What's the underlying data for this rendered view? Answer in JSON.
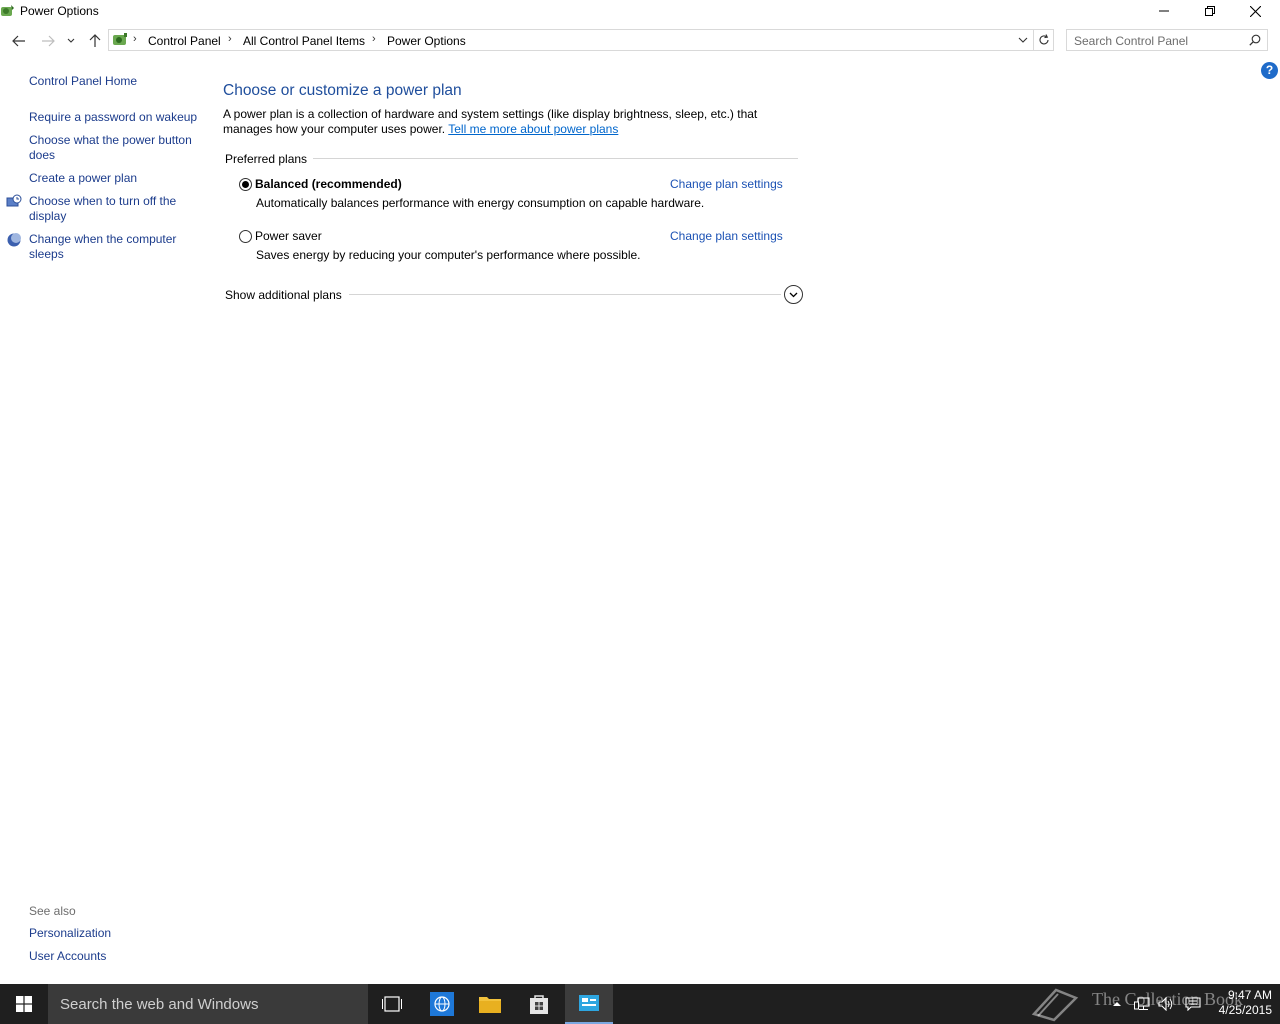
{
  "window": {
    "title": "Power Options"
  },
  "navbar": {
    "breadcrumbs": [
      "Control Panel",
      "All Control Panel Items",
      "Power Options"
    ],
    "search_placeholder": "Search Control Panel"
  },
  "sidebar": {
    "home": "Control Panel Home",
    "links": [
      "Require a password on wakeup",
      "Choose what the power button does",
      "Create a power plan",
      "Choose when to turn off the display",
      "Change when the computer sleeps"
    ],
    "see_also_label": "See also",
    "see_also": [
      "Personalization",
      "User Accounts"
    ]
  },
  "main": {
    "heading": "Choose or customize a power plan",
    "description": "A power plan is a collection of hardware and system settings (like display brightness, sleep, etc.) that manages how your computer uses power.",
    "learn_more_link": "Tell me more about power plans",
    "preferred_label": "Preferred plans",
    "plans": [
      {
        "name": "Balanced (recommended)",
        "description": "Automatically balances performance with energy consumption on capable hardware.",
        "change_label": "Change plan settings",
        "selected": true
      },
      {
        "name": "Power saver",
        "description": "Saves energy by reducing your computer's performance where possible.",
        "change_label": "Change plan settings",
        "selected": false
      }
    ],
    "additional_plans_label": "Show additional plans"
  },
  "taskbar": {
    "search_text": "Search the web and Windows",
    "watermark": "The Collection Book",
    "time": "9:47 AM",
    "date": "4/25/2015"
  },
  "colors": {
    "link": "#1c3c8c",
    "heading": "#1f4e9c",
    "taskbar": "#1f1f1f",
    "help": "#1f6bc9"
  }
}
